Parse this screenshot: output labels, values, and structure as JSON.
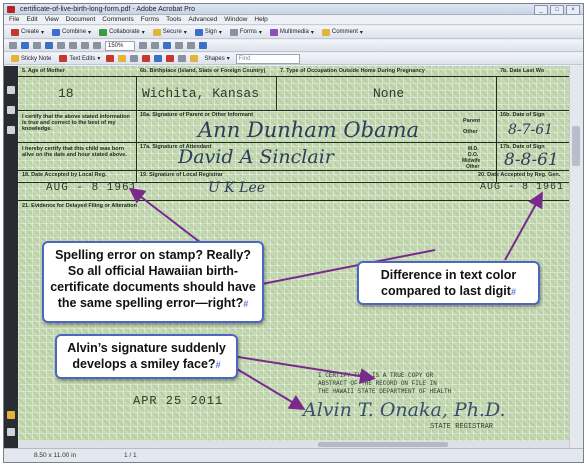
{
  "window": {
    "title": "certificate-of-live-birth-long-form.pdf - Adobe Acrobat Pro",
    "buttons": [
      "_",
      "□",
      "×"
    ]
  },
  "menubar": [
    "File",
    "Edit",
    "View",
    "Document",
    "Comments",
    "Forms",
    "Tools",
    "Advanced",
    "Window",
    "Help"
  ],
  "toolbar1": [
    {
      "label": "Create",
      "icon": "create-pdf-icon"
    },
    {
      "label": "Combine",
      "icon": "combine-icon"
    },
    {
      "label": "Collaborate",
      "icon": "collaborate-icon"
    },
    {
      "label": "Secure",
      "icon": "lock-icon"
    },
    {
      "label": "Sign",
      "icon": "pen-icon"
    },
    {
      "label": "Forms",
      "icon": "forms-icon"
    },
    {
      "label": "Multimedia",
      "icon": "film-icon"
    },
    {
      "label": "Comment",
      "icon": "speech-bubble-icon"
    }
  ],
  "toolbar2": {
    "zoom": "150%"
  },
  "toolbar3": {
    "items": [
      "Sticky Note",
      "Text Edits"
    ],
    "shapes_label": "Shapes",
    "find_placeholder": "Find"
  },
  "document": {
    "row1": {
      "labels": [
        "5. Age of Mother",
        "6b. Birthplace (Island, State or Foreign Country)",
        "7. Type of Occupation Outside Home During Pregnancy",
        "7b. Date Last Wo"
      ],
      "age": "18",
      "birthplace": "Wichita, Kansas",
      "occupation": "None"
    },
    "row2": {
      "label_certify": "I certify that the above stated information is true and correct to the best of my knowledge.",
      "label_sig_parent": "16a. Signature of Parent or Other Informant",
      "signature": "Ann Dunham Obama",
      "parent_label": "Parent",
      "other_label": "Other",
      "label_date": "16b. Date of Sign",
      "date": "8-7-61"
    },
    "row3": {
      "label_certify": "I hereby certify that this child was born alive on the date and hour stated above.",
      "label_sig_attendant": "17a. Signature of Attendant",
      "signature": "David A Sinclair",
      "md_labels": [
        "M.D.",
        "D.O.",
        "Midwife",
        "Other"
      ],
      "label_date": "17b. Date of Sign",
      "date": "8-8-61"
    },
    "row4": {
      "label_date_accepted": "18. Date Accepted by Local Reg.",
      "stamp_date_1": "AUG - 8 1961",
      "label_sig_registrar": "19. Signature of Local Registrar",
      "signature": "U K Lee",
      "label_date_accepted_2": "20. Date Accepted by Reg. Gen.",
      "stamp_date_2": "AUG - 8 1961"
    },
    "row5": {
      "label": "21. Evidence for Delayed Filing or Alteration"
    },
    "certification": {
      "lines": [
        "I CERTIFY THIS IS A TRUE COPY OR",
        "ABSTRACT OF THE RECORD ON FILE IN",
        "THE HAWAII STATE DEPARTMENT OF HEALTH"
      ],
      "date": "APR 25 2011",
      "signature": "Alvin T. Onaka, Ph.D.",
      "title": "STATE REGISTRAR"
    }
  },
  "callouts": [
    {
      "text": "Spelling error on stamp? Really? So all official Hawaiian birth-certificate documents should have the same spelling error—right?",
      "mark": "#"
    },
    {
      "text": "Difference in text color compared to last digit",
      "mark": "#"
    },
    {
      "text": "Alvin’s signature suddenly develops a smiley face?",
      "mark": "#"
    }
  ],
  "statusbar": {
    "page_size": "8.50 x 11.00 in",
    "page_nav": "1 / 1"
  },
  "colors": {
    "callout_border": "#4b66c4",
    "arrow": "#7a2a8c",
    "doc_background": "#c4d8b1"
  }
}
